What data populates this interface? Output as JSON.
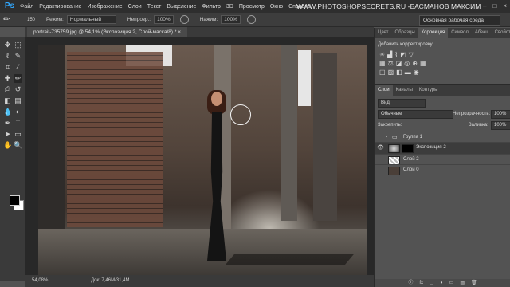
{
  "app": {
    "logo": "Ps"
  },
  "menu": [
    "Файл",
    "Редактирование",
    "Изображение",
    "Слои",
    "Текст",
    "Выделение",
    "Фильтр",
    "3D",
    "Просмотр",
    "Окно",
    "Справка"
  ],
  "watermark": "WWW.PHOTOSHOPSECRETS.RU -БАСМАНОВ МАКСИМ",
  "window_controls": [
    "–",
    "□",
    "×"
  ],
  "options": {
    "brush_size": "150",
    "mode_label": "Режим:",
    "mode_value": "Нормальный",
    "opacity_label": "Непрозр.:",
    "opacity_value": "100%",
    "pressure_label": "Нажим:",
    "pressure_value": "100%",
    "workspace": "Основная рабочая среда"
  },
  "document": {
    "tab": "portrait-735759.jpg @ 54,1% (Экспозиция 2, Слой-маска/8) * ×",
    "zoom": "54,08%",
    "doc_info": "Док: 7,46M/31,4M"
  },
  "tools": [
    {
      "name": "move-tool",
      "glyph": "✥"
    },
    {
      "name": "marquee-tool",
      "glyph": "⬚"
    },
    {
      "name": "lasso-tool",
      "glyph": "ℓ"
    },
    {
      "name": "quick-select-tool",
      "glyph": "✎"
    },
    {
      "name": "crop-tool",
      "glyph": "⌗"
    },
    {
      "name": "eyedropper-tool",
      "glyph": "⁄"
    },
    {
      "name": "healing-tool",
      "glyph": "✚"
    },
    {
      "name": "brush-tool",
      "glyph": "✏"
    },
    {
      "name": "stamp-tool",
      "glyph": "⎙"
    },
    {
      "name": "history-brush-tool",
      "glyph": "↺"
    },
    {
      "name": "eraser-tool",
      "glyph": "◧"
    },
    {
      "name": "gradient-tool",
      "glyph": "▤"
    },
    {
      "name": "blur-tool",
      "glyph": "💧"
    },
    {
      "name": "dodge-tool",
      "glyph": "◐"
    },
    {
      "name": "pen-tool",
      "glyph": "✒"
    },
    {
      "name": "type-tool",
      "glyph": "T"
    },
    {
      "name": "path-select-tool",
      "glyph": "➤"
    },
    {
      "name": "shape-tool",
      "glyph": "▭"
    },
    {
      "name": "hand-tool",
      "glyph": "✋"
    },
    {
      "name": "zoom-tool",
      "glyph": "🔍"
    }
  ],
  "right_panel": {
    "tabs": [
      "Цвет",
      "Образцы",
      "Коррекция",
      "Символ",
      "Абзац",
      "Свойства"
    ],
    "active_tab": "Коррекция",
    "adjustments_title": "Добавить корректировку",
    "layer_tabs": [
      "Слои",
      "Каналы",
      "Контуры"
    ],
    "layer_filter": "Вид",
    "blend_mode": "Обычные",
    "opacity_label": "Непрозрачность:",
    "opacity_value": "100%",
    "lock_label": "Закрепить:",
    "fill_label": "Заливка:",
    "fill_value": "100%",
    "layers": [
      {
        "name": "Группа 1",
        "visible": false,
        "type": "group"
      },
      {
        "name": "Экспозиция 2",
        "visible": true,
        "type": "adjustment",
        "selected": true
      },
      {
        "name": "Слой 2",
        "visible": false,
        "type": "pixel"
      },
      {
        "name": "Слой 0",
        "visible": false,
        "type": "pixel"
      }
    ],
    "bottom_icons": [
      "ⓘ",
      "fx",
      "◻",
      "◑",
      "▭",
      "▤",
      "🗑"
    ]
  },
  "colors": {
    "accent": "#31a8ff",
    "fg": "#000000",
    "bg": "#ffffff"
  }
}
